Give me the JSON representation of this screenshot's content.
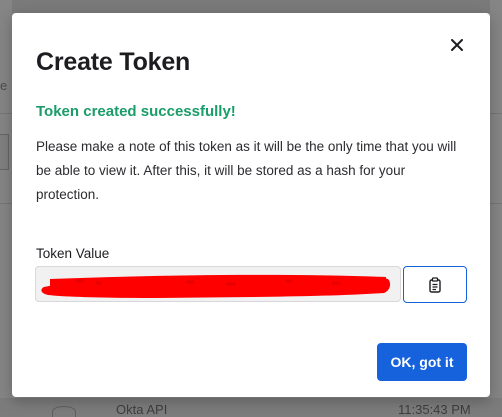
{
  "background": {
    "left_fragment": "e",
    "row_name": "Okta API",
    "row_time": "11:35:43 PM"
  },
  "modal": {
    "title": "Create Token",
    "success_message": "Token created successfully!",
    "note": "Please make a note of this token as it will be the only time that you will be able to view it. After this, it will be stored as a hash for your protection.",
    "token_label": "Token Value",
    "token_value_redacted": true,
    "ok_button": "OK, got it"
  },
  "icons": {
    "close": "close-icon",
    "copy": "clipboard-icon"
  },
  "colors": {
    "accent": "#1662dd",
    "success": "#1a9c6b",
    "redaction": "#ff0000"
  }
}
